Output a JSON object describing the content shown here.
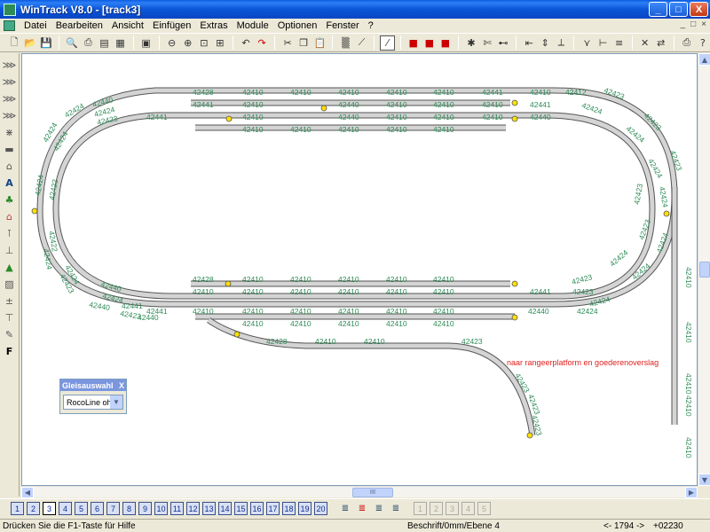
{
  "window": {
    "title": "WinTrack  V8.0 - [track3]",
    "min": "_",
    "max": "□",
    "close": "X"
  },
  "menu": [
    "Datei",
    "Bearbeiten",
    "Ansicht",
    "Einfügen",
    "Extras",
    "Module",
    "Optionen",
    "Fenster",
    "?"
  ],
  "mdi_controls": [
    "_",
    "□",
    "×"
  ],
  "toolbar_icons": [
    "new-file-icon",
    "open-folder-icon",
    "save-icon",
    "print-preview-icon",
    "print-icon",
    "page-setup-icon",
    "parts-list-icon",
    "image-icon",
    "zoom-out-icon",
    "zoom-in-icon",
    "zoom-window-icon",
    "zoom-fit-icon",
    "undo-icon",
    "redo-icon",
    "cut-icon",
    "copy-icon",
    "paste-icon",
    "grid-icon",
    "flex-track-icon",
    "straight-icon",
    "layer-red-icon",
    "layer-red2-icon",
    "layer-red3-icon",
    "connect-icon",
    "scissors-icon",
    "join-icon",
    "measure-icon",
    "height-icon",
    "slope-icon",
    "turnout-icon",
    "junction-icon",
    "align-icon",
    "cross-icon",
    "switch-icon",
    "print-icon2",
    "help-icon"
  ],
  "left_tools": [
    "track-icon",
    "track2-icon",
    "track3-icon",
    "track4-icon",
    "cut-track-icon",
    "platform-icon",
    "building-icon",
    "text-icon",
    "tree-icon",
    "house-icon",
    "road-icon",
    "signal-icon",
    "landscape-icon",
    "terrain-icon",
    "height-marker-icon",
    "slope-marker-icon",
    "pen-icon",
    "font-icon"
  ],
  "layers": [
    "1",
    "2",
    "3",
    "4",
    "5",
    "6",
    "7",
    "8",
    "9",
    "10",
    "11",
    "12",
    "13",
    "14",
    "15",
    "16",
    "17",
    "18",
    "19",
    "20"
  ],
  "active_layer": "3",
  "status": {
    "help": "Drücken Sie die  F1-Taste für Hilfe",
    "mode": "Beschrift/0mm/Ebene 4",
    "arrow": "<- 1794 ->",
    "coords": "+02230  -00662"
  },
  "panel": {
    "title": "Gleisauswahl",
    "close": "X",
    "value": "RocoLine ohr"
  },
  "scrollbar": {
    "h_thumb_grip": "III"
  },
  "annotation": "naar rangeerplatform en goederenoverslag",
  "track_labels": {
    "top_row1": [
      "42428",
      "42410",
      "42410",
      "42410",
      "42410",
      "42410",
      "42441",
      "42410",
      "42412"
    ],
    "top_row2": [
      "42441",
      "42410",
      "42440",
      "42410",
      "42410",
      "42410",
      "42441"
    ],
    "top_row3": [
      "42441",
      "42410",
      "42440",
      "42410",
      "42410",
      "42410",
      "42440"
    ],
    "top_row4": [
      "42410",
      "42410",
      "42410",
      "42410",
      "42410"
    ],
    "bottom_row1": [
      "42428",
      "42410",
      "42410",
      "42410",
      "42410",
      "42410"
    ],
    "bottom_row2": [
      "42410",
      "42410",
      "42410",
      "42410",
      "42410",
      "42410",
      "42441",
      "42423"
    ],
    "bottom_row3": [
      "42441",
      "42410",
      "42410",
      "42410",
      "42410",
      "42410",
      "42410",
      "42440",
      "42424"
    ],
    "bottom_row4": [
      "42410",
      "42410",
      "42410",
      "42410",
      "42410"
    ],
    "bottom_row5": [
      "42428",
      "42410",
      "42410",
      "42423"
    ],
    "left_curve": [
      "42440",
      "42424",
      "42423",
      "42424",
      "42424",
      "42424",
      "42424",
      "42422",
      "42424",
      "42422",
      "42424",
      "42423",
      "42440",
      "42424",
      "42440",
      "42423",
      "42441",
      "42440"
    ],
    "right_curve": [
      "42423",
      "42424",
      "42423",
      "42424",
      "42423",
      "42424",
      "42424",
      "42423",
      "42423",
      "42424",
      "42424",
      "42424",
      "42423",
      "42424"
    ],
    "right_spur": [
      "42410",
      "42410",
      "42410",
      "42410",
      "42410"
    ],
    "branch": [
      "42423",
      "42423",
      "42423"
    ]
  }
}
